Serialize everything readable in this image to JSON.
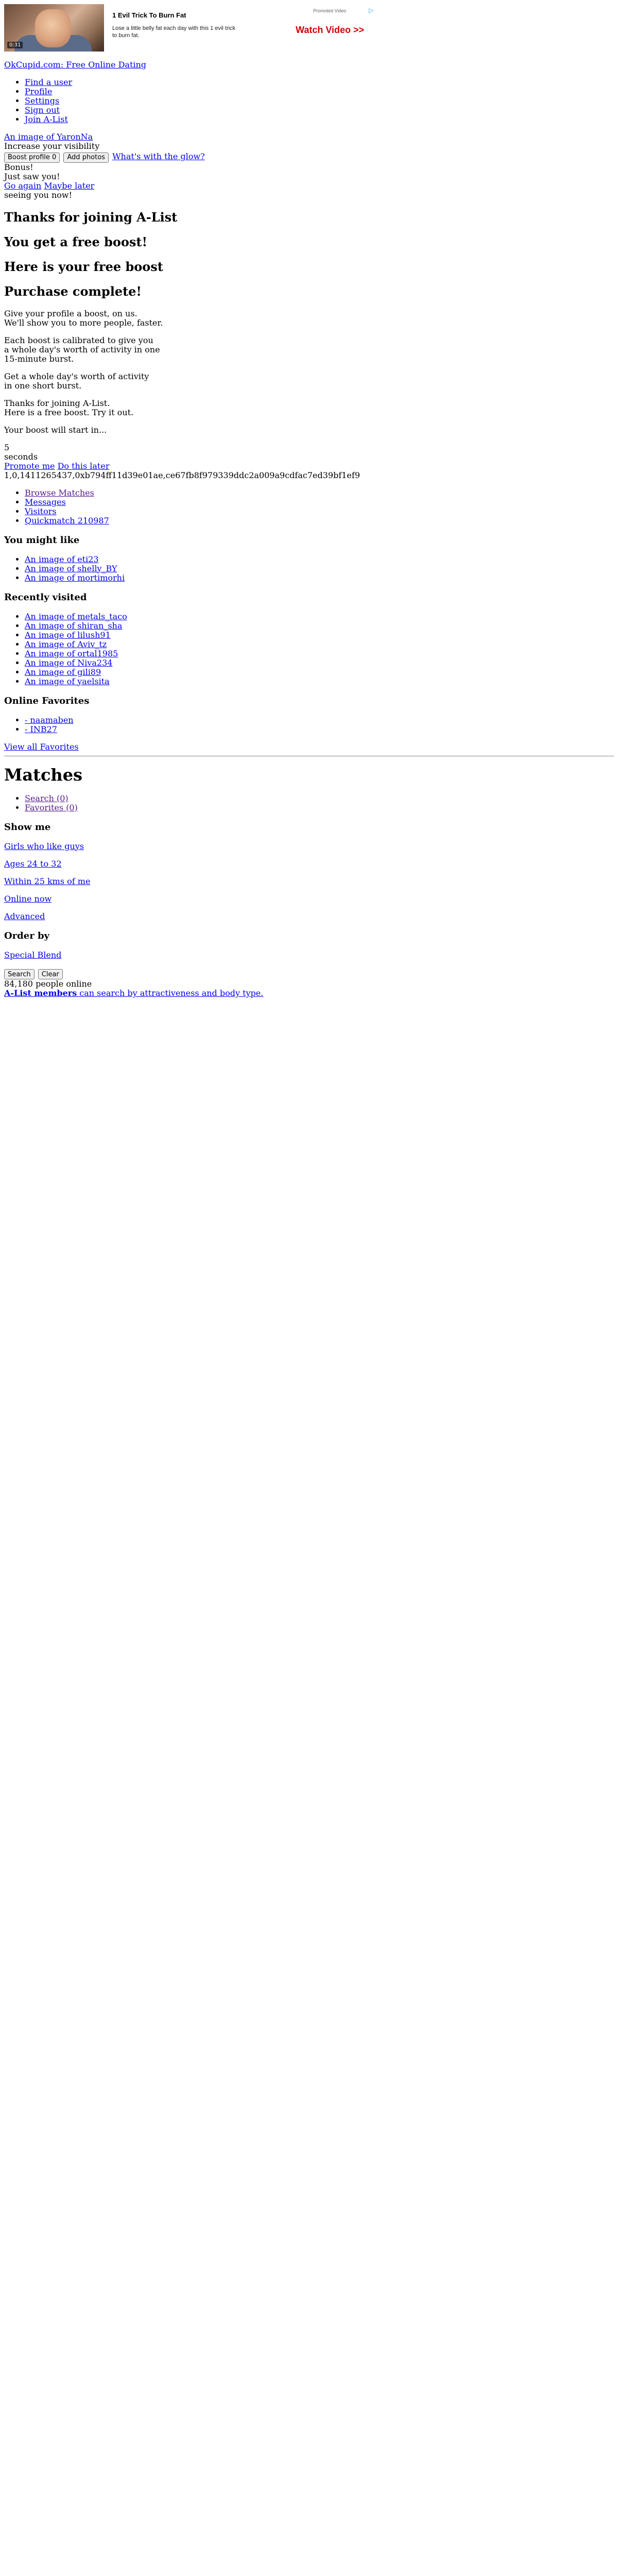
{
  "ad": {
    "duration": "0:31",
    "title": "1 Evil Trick To Burn Fat",
    "desc": "Lose a little belly fat each day with this 1 evil trick to burn fat.",
    "promoted": "Promoted Video",
    "adchoice_icon": "play-triangle-icon",
    "cta": "Watch Video >>"
  },
  "site_link": "OkCupid.com: Free Online Dating",
  "nav": [
    "Find a user",
    "Profile",
    "Settings",
    "Sign out",
    "Join A-List"
  ],
  "boost": {
    "avatar_alt": "An image of YaronNa",
    "visibility_text": "Increase your visibility",
    "boost_button": "Boost profile 0",
    "photos_button": "Add photos",
    "glow_link": "What's with the glow?",
    "bonus": "Bonus!",
    "just_saw": "Just saw you!",
    "go_again": "Go again",
    "maybe_later": "Maybe later",
    "seeing_you": "seeing you now!"
  },
  "headings": {
    "thanks": "Thanks for joining A-List",
    "free_boost": "You get a free boost!",
    "here_is": "Here is your free boost",
    "purchase": "Purchase complete!"
  },
  "body_paragraphs": {
    "p1": [
      "Give your profile a boost, on us.",
      "We'll show you to more people, faster."
    ],
    "p2": [
      "Each boost is calibrated to give you",
      "a whole day's worth of activity in one",
      "15-minute burst."
    ],
    "p3": [
      "Get a whole day's worth of activity",
      "in one short burst."
    ],
    "p4": [
      "Thanks for joining A-List.",
      "Here is a free boost. Try it out."
    ],
    "p5": "Your boost will start in...",
    "countdown": "5",
    "seconds": "seconds",
    "promote": "Promote me",
    "do_later": "Do this later",
    "hash": "1,0,1411265437,0xb794ff11d39e01ae,ce67fb8f979339ddc2a009a9cdfac7ed39bf1ef9"
  },
  "subnav": [
    "Browse Matches",
    "Messages",
    "Visitors",
    "Quickmatch 210987"
  ],
  "you_might_like": {
    "heading": "You might like",
    "items": [
      "An image of eti23",
      "An image of shelly_BY",
      "An image of mortimorhi"
    ]
  },
  "recently_visited": {
    "heading": "Recently visited",
    "items": [
      "An image of metals_taco",
      "An image of shiran_sha",
      "An image of lilush91",
      "An image of Aviv_tz",
      "An image of ortal1985",
      "An image of Niva234",
      "An image of gili89",
      "An image of yaelsita"
    ]
  },
  "online_favorites": {
    "heading": "Online Favorites",
    "items": [
      "- naamaben",
      "- INB27"
    ],
    "view_all": "View all Favorites"
  },
  "matches": {
    "title": "Matches",
    "tabs": [
      "Search (0)",
      "Favorites (0)"
    ],
    "show_me_heading": "Show me",
    "filters": [
      "Girls who like guys",
      "Ages 24 to 32",
      "Within 25 kms of me",
      "Online now",
      "Advanced"
    ],
    "order_heading": "Order by",
    "order_value": "Special Blend",
    "search_button": "Search",
    "clear_button": "Clear",
    "online_count": "84,180 people online",
    "alist_bold": "A-List members",
    "alist_rest": " can search by attractiveness and body type."
  },
  "colors": {
    "link": "#0000ee",
    "visited": "#551a8b",
    "cta": "#d60000"
  }
}
